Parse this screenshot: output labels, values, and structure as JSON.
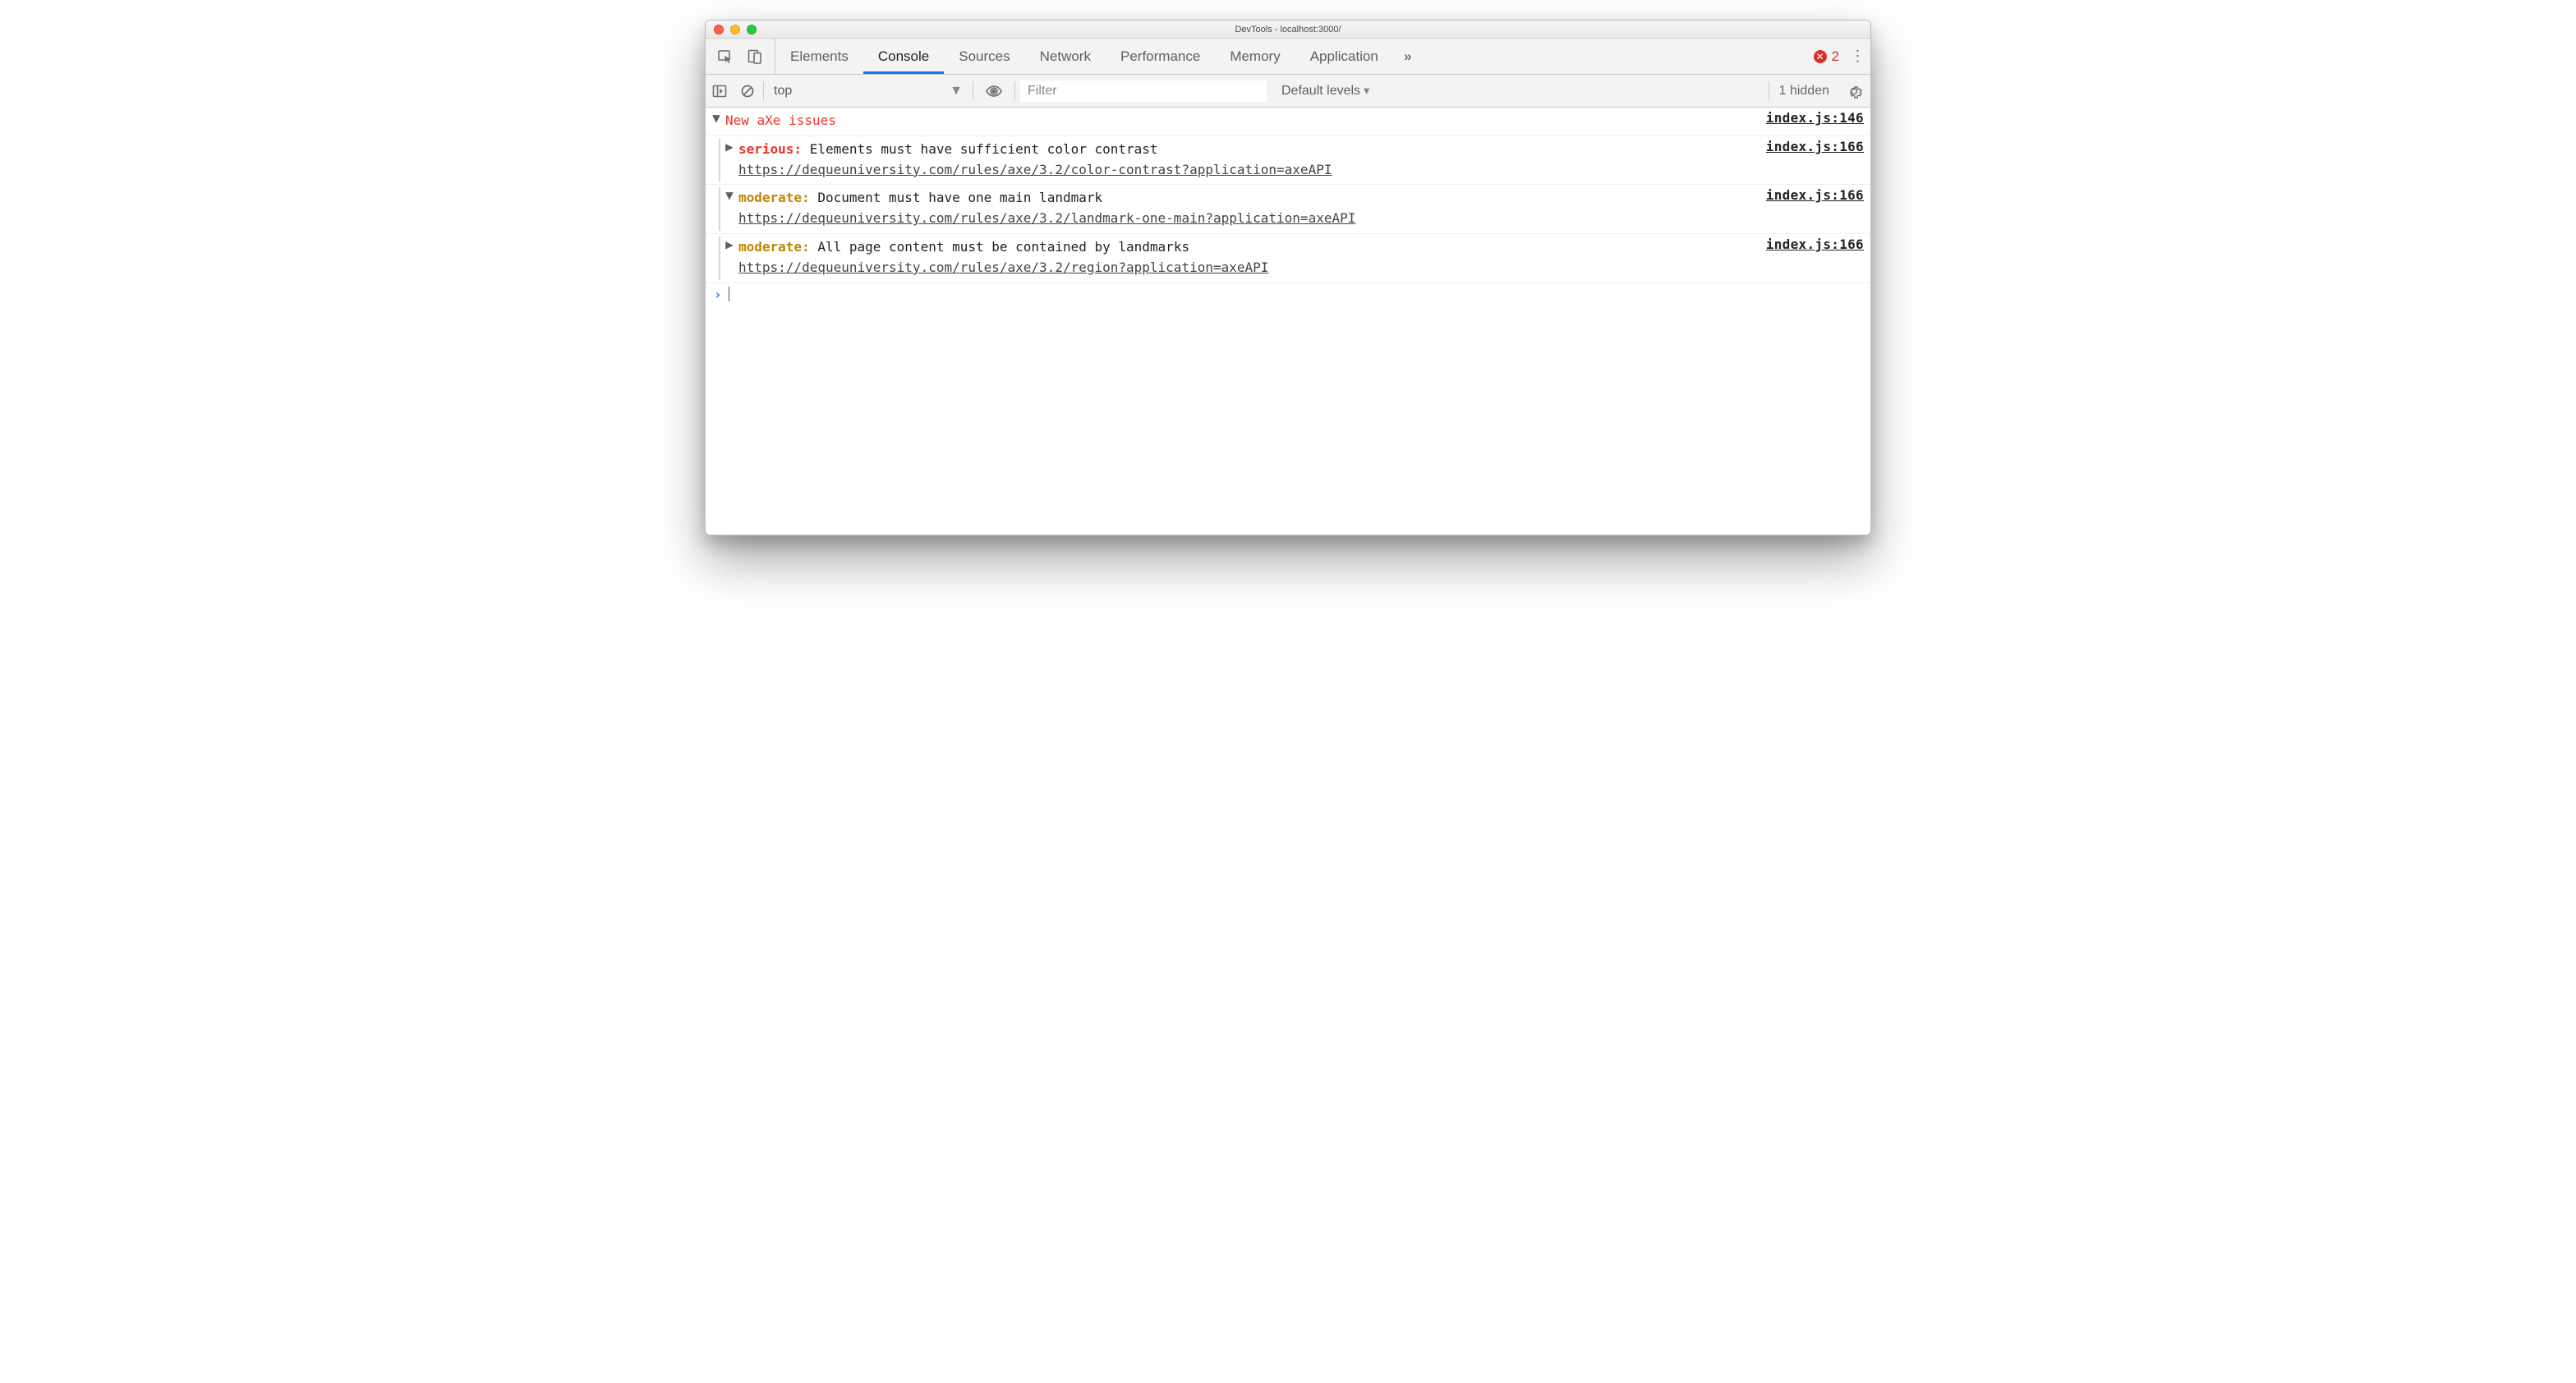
{
  "window": {
    "title": "DevTools - localhost:3000/"
  },
  "tabs": {
    "items": [
      "Elements",
      "Console",
      "Sources",
      "Network",
      "Performance",
      "Memory",
      "Application"
    ],
    "active_index": 1,
    "error_count": "2"
  },
  "console_toolbar": {
    "context": "top",
    "filter_placeholder": "Filter",
    "levels": "Default levels",
    "hidden": "1 hidden"
  },
  "console": {
    "group": {
      "title": "New aXe issues",
      "source": "index.js:146"
    },
    "messages": [
      {
        "expanded": false,
        "severity": "serious",
        "text": "Elements must have sufficient color contrast",
        "url": "https://dequeuniversity.com/rules/axe/3.2/color-contrast?application=axeAPI",
        "source": "index.js:166"
      },
      {
        "expanded": true,
        "severity": "moderate",
        "text": "Document must have one main landmark",
        "url": "https://dequeuniversity.com/rules/axe/3.2/landmark-one-main?application=axeAPI",
        "source": "index.js:166"
      },
      {
        "expanded": false,
        "severity": "moderate",
        "text": "All page content must be contained by landmarks",
        "url": "https://dequeuniversity.com/rules/axe/3.2/region?application=axeAPI",
        "source": "index.js:166"
      }
    ]
  }
}
